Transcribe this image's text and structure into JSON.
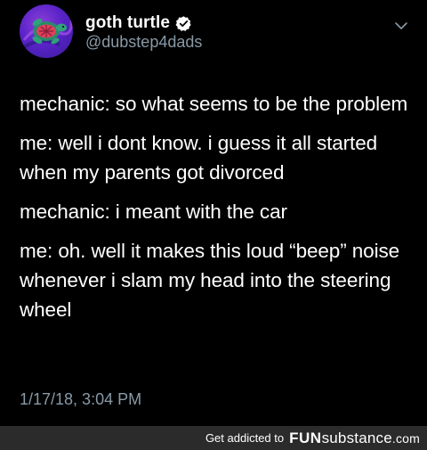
{
  "tweet": {
    "display_name": "goth turtle",
    "handle": "@dubstep4dads",
    "lines": [
      "mechanic: so what seems to be the problem",
      "me: well i dont know. i guess it all started when my parents got divorced",
      "mechanic: i meant with the car",
      "me: oh. well it makes this loud “beep” noise whenever i slam my head into the steering wheel"
    ],
    "timestamp": "1/17/18, 3:04 PM",
    "icons": {
      "verified": "verified-badge-icon",
      "menu": "chevron-down-icon"
    }
  },
  "footer": {
    "prefix": "Get addicted to",
    "brand_bold": "FUN",
    "brand_light": "substance",
    "brand_domain": ".com"
  },
  "colors": {
    "background": "#000000",
    "text_primary": "#ffffff",
    "text_secondary": "#8899a6",
    "footer_background": "#2b2b2b",
    "avatar_purple": "#5a23c9"
  }
}
